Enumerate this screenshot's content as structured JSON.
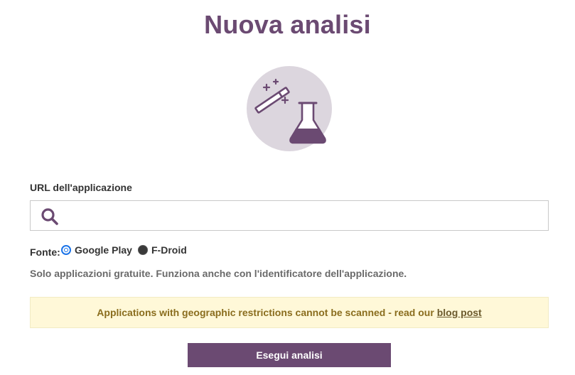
{
  "page": {
    "title": "Nuova analisi"
  },
  "hero": {
    "icon": "magic-wand-flask-icon",
    "colors": {
      "circle": "#dcd6de",
      "stroke": "#6b4a72"
    }
  },
  "form": {
    "url_label": "URL dell'applicazione",
    "url_value": "",
    "url_placeholder": "",
    "source_label": "Fonte:",
    "sources": [
      {
        "label": "Google Play",
        "selected": true
      },
      {
        "label": "F-Droid",
        "selected": false
      }
    ],
    "hint": "Solo applicazioni gratuite. Funziona anche con l'identificatore dell'applicazione."
  },
  "notice": {
    "text": "Applications with geographic restrictions cannot be scanned - read our",
    "link_label": "blog post"
  },
  "actions": {
    "run_label": "Esegui analisi"
  },
  "theme": {
    "accent": "#6b4a72",
    "notice_bg": "#fff8d8",
    "notice_text": "#8a6d1e"
  }
}
